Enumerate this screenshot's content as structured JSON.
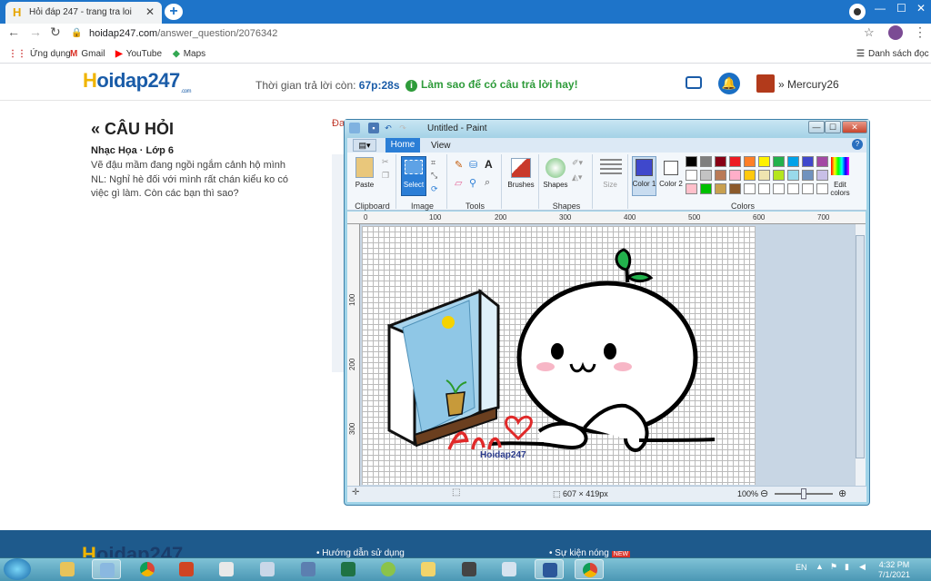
{
  "browser": {
    "tab_title": "Hỏi đáp 247 - trang tra loi",
    "url_host": "hoidap247.com",
    "url_path": "/answer_question/2076342",
    "bookmarks": [
      {
        "label": "Ứng dụng",
        "icon": "apps-icon"
      },
      {
        "label": "Gmail",
        "icon": "gmail-icon"
      },
      {
        "label": "YouTube",
        "icon": "youtube-icon"
      },
      {
        "label": "Maps",
        "icon": "maps-icon"
      }
    ],
    "reading_list": "Danh sách đọc"
  },
  "site": {
    "logo_main": "oidap247",
    "logo_h": "H",
    "logo_sub": ".com",
    "timer_label": "Thời gian trả lời còn:",
    "timer_value": "67p:28s",
    "hint": "Làm sao để có câu trả lời hay!",
    "username": "Mercury26",
    "accent": "#1a5ca8"
  },
  "question": {
    "heading": "CÂU HỎI",
    "subject": "Nhạc Họa",
    "grade": "Lớp 6",
    "line1": "Vẽ đậu mầm đang ngồi ngắm cảnh hộ mình",
    "line2": "NL: Nghỉ hè đối với mình rất chán kiểu ko có",
    "line3": "việc gì làm. Còn các bạn thì sao?",
    "cut_text": "Đa"
  },
  "footer": {
    "logo_main": "oidap247",
    "logo_h": "H",
    "link1": "Hướng dẫn sử dụng",
    "link2": "Sự kiện nóng",
    "new_badge": "NEW"
  },
  "paint": {
    "title": "Untitled - Paint",
    "tabs": [
      "Home",
      "View"
    ],
    "groups": {
      "clipboard": "Clipboard",
      "image": "Image",
      "tools": "Tools",
      "shapes": "Shapes",
      "colors": "Colors"
    },
    "buttons": {
      "paste": "Paste",
      "select": "Select",
      "brushes": "Brushes",
      "shapes": "Shapes",
      "size": "Size",
      "color1": "Color 1",
      "color2": "Color 2",
      "edit_colors": "Edit colors"
    },
    "palette": [
      "#000000",
      "#7f7f7f",
      "#880015",
      "#ed1c24",
      "#ff7f27",
      "#fff200",
      "#22b14c",
      "#00a2e8",
      "#3f48cc",
      "#a349a4",
      "#ffffff",
      "#c3c3c3",
      "#b97a57",
      "#ffaec9",
      "#ffc90e",
      "#efe4b0",
      "#b5e61d",
      "#99d9ea",
      "#7092be",
      "#c8bfe7",
      "#ffc0cb",
      "#00c000",
      "#c8a050",
      "#8b5a2b",
      "#ffffff",
      "#ffffff",
      "#ffffff",
      "#ffffff",
      "#ffffff",
      "#ffffff"
    ],
    "color1": "#3f48cc",
    "color2": "#ffffff",
    "ruler_top": [
      "0",
      "100",
      "200",
      "300",
      "400",
      "500",
      "600",
      "700"
    ],
    "ruler_left": [
      "100",
      "200",
      "300"
    ],
    "canvas_size": "607 × 419px",
    "zoom": "100%",
    "signature": "Ann",
    "watermark": "Hoidap247"
  },
  "taskbar": {
    "lang": "EN",
    "time": "4:32 PM",
    "date": "7/1/2021"
  }
}
